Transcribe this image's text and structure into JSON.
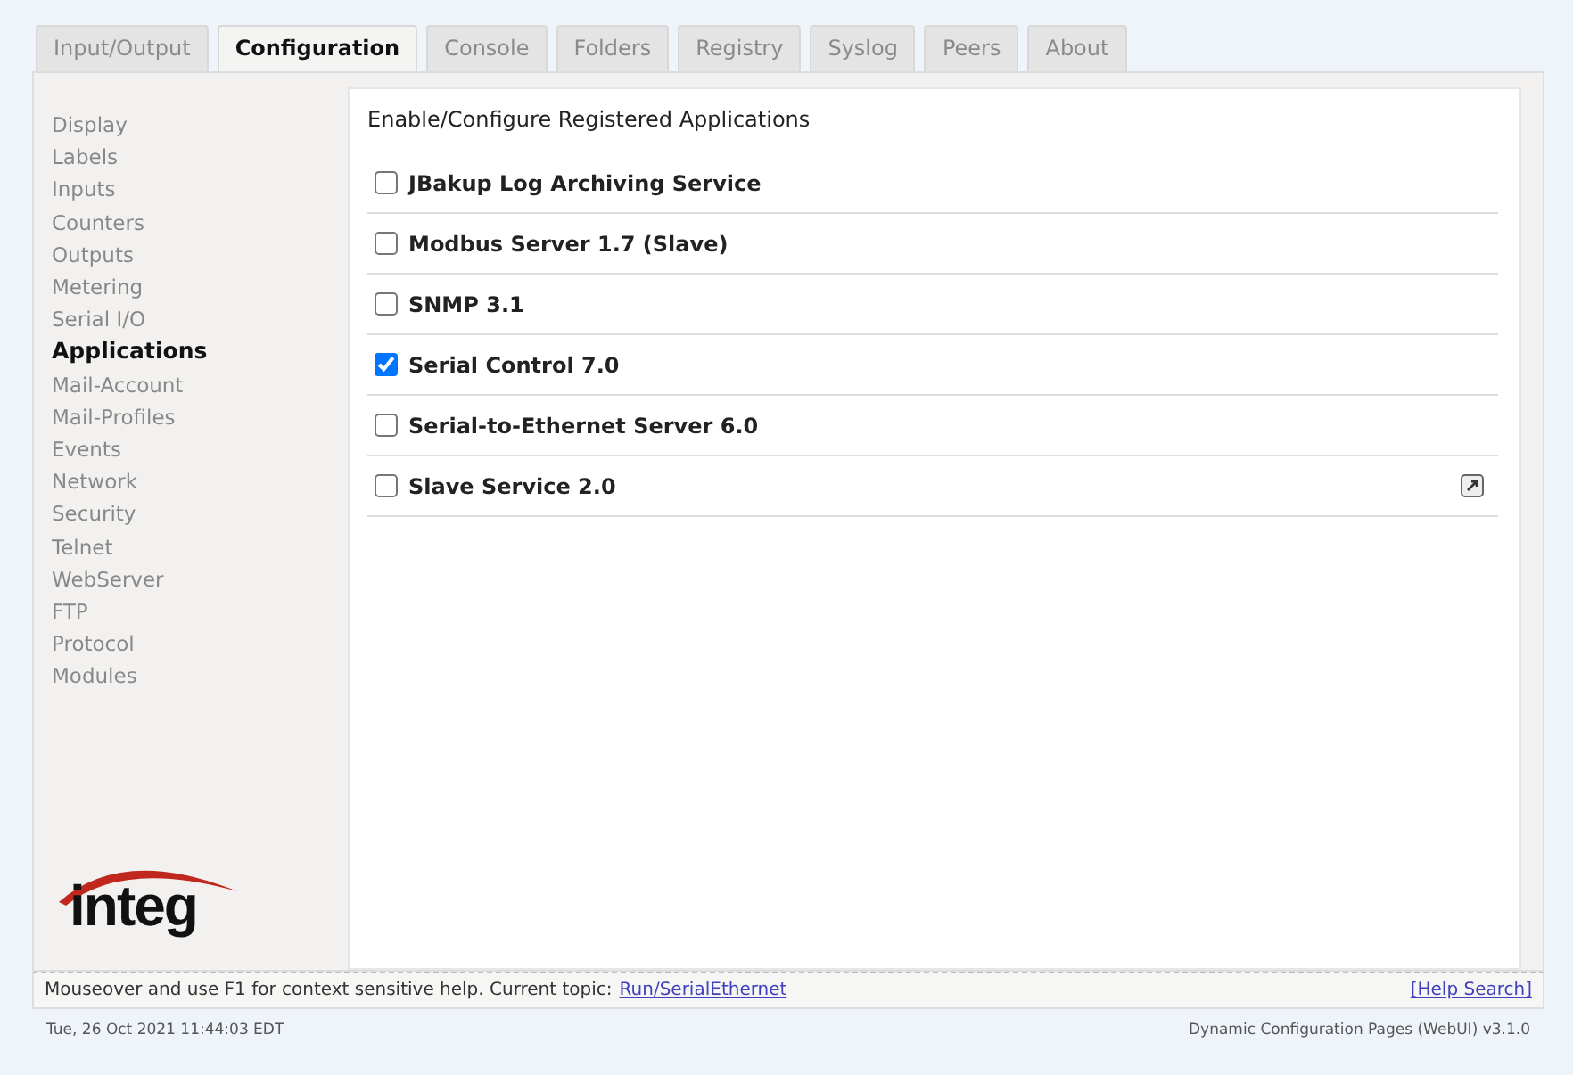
{
  "tabs": [
    {
      "label": "Input/Output",
      "selected": false
    },
    {
      "label": "Configuration",
      "selected": true
    },
    {
      "label": "Console",
      "selected": false
    },
    {
      "label": "Folders",
      "selected": false
    },
    {
      "label": "Registry",
      "selected": false
    },
    {
      "label": "Syslog",
      "selected": false
    },
    {
      "label": "Peers",
      "selected": false
    },
    {
      "label": "About",
      "selected": false
    }
  ],
  "sidebar": {
    "items": [
      {
        "label": "Display",
        "selected": false
      },
      {
        "label": "Labels",
        "selected": false
      },
      {
        "label": "Inputs",
        "selected": false
      },
      {
        "label": "Counters",
        "selected": false
      },
      {
        "label": "Outputs",
        "selected": false
      },
      {
        "label": "Metering",
        "selected": false
      },
      {
        "label": "Serial I/O",
        "selected": false
      },
      {
        "label": "Applications",
        "selected": true
      },
      {
        "label": "Mail-Account",
        "selected": false
      },
      {
        "label": "Mail-Profiles",
        "selected": false
      },
      {
        "label": "Events",
        "selected": false
      },
      {
        "label": "Network",
        "selected": false
      },
      {
        "label": "Security",
        "selected": false
      },
      {
        "label": "Telnet",
        "selected": false
      },
      {
        "label": "WebServer",
        "selected": false
      },
      {
        "label": "FTP",
        "selected": false
      },
      {
        "label": "Protocol",
        "selected": false
      },
      {
        "label": "Modules",
        "selected": false
      }
    ],
    "logo": "integ"
  },
  "content": {
    "heading": "Enable/Configure Registered Applications",
    "applications": [
      {
        "label": "JBakup Log Archiving Service",
        "checked": false,
        "popout": false
      },
      {
        "label": "Modbus Server 1.7 (Slave)",
        "checked": false,
        "popout": false
      },
      {
        "label": "SNMP 3.1",
        "checked": false,
        "popout": false
      },
      {
        "label": "Serial Control 7.0",
        "checked": true,
        "popout": false
      },
      {
        "label": "Serial-to-Ethernet Server 6.0",
        "checked": false,
        "popout": false
      },
      {
        "label": "Slave Service 2.0",
        "checked": false,
        "popout": true
      }
    ]
  },
  "help_bar": {
    "text": "Mouseover and use F1 for context sensitive help. Current topic:",
    "topic_link": "Run/SerialEthernet",
    "search_link": "[Help Search]"
  },
  "status_bar": {
    "datetime": "Tue, 26 Oct 2021 11:44:03 EDT",
    "version": "Dynamic Configuration Pages (WebUI) v3.1.0"
  }
}
